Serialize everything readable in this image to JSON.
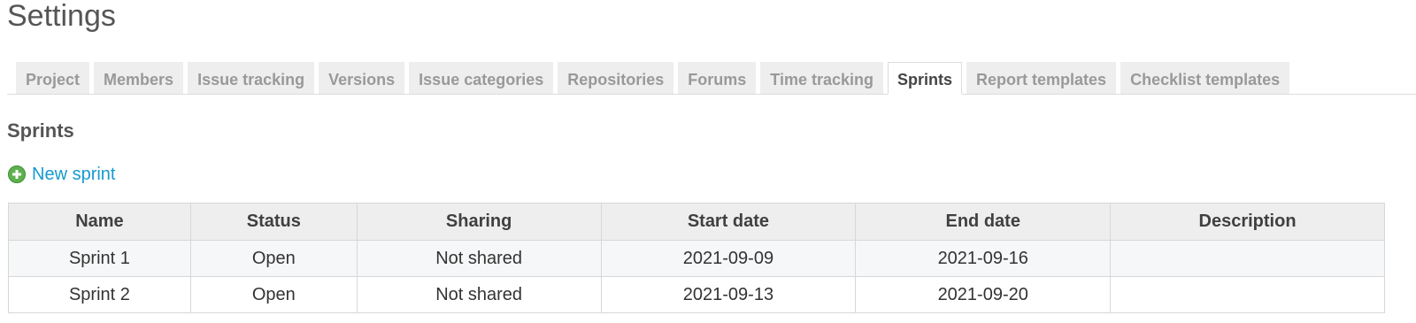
{
  "page": {
    "title": "Settings"
  },
  "tabs": [
    {
      "label": "Project",
      "selected": false
    },
    {
      "label": "Members",
      "selected": false
    },
    {
      "label": "Issue tracking",
      "selected": false
    },
    {
      "label": "Versions",
      "selected": false
    },
    {
      "label": "Issue categories",
      "selected": false
    },
    {
      "label": "Repositories",
      "selected": false
    },
    {
      "label": "Forums",
      "selected": false
    },
    {
      "label": "Time tracking",
      "selected": false
    },
    {
      "label": "Sprints",
      "selected": true
    },
    {
      "label": "Report templates",
      "selected": false
    },
    {
      "label": "Checklist templates",
      "selected": false
    }
  ],
  "section": {
    "title": "Sprints",
    "new_link_label": "New sprint",
    "new_link_icon": "add-icon"
  },
  "table": {
    "columns": [
      "Name",
      "Status",
      "Sharing",
      "Start date",
      "End date",
      "Description"
    ],
    "rows": [
      [
        "Sprint 1",
        "Open",
        "Not shared",
        "2021-09-09",
        "2021-09-16",
        ""
      ],
      [
        "Sprint 2",
        "Open",
        "Not shared",
        "2021-09-13",
        "2021-09-20",
        ""
      ]
    ]
  },
  "colors": {
    "link": "#169ace",
    "tab_inactive_bg": "#eeeeee",
    "header_bg": "#eeeeee",
    "add_icon": "#5fb04f"
  }
}
